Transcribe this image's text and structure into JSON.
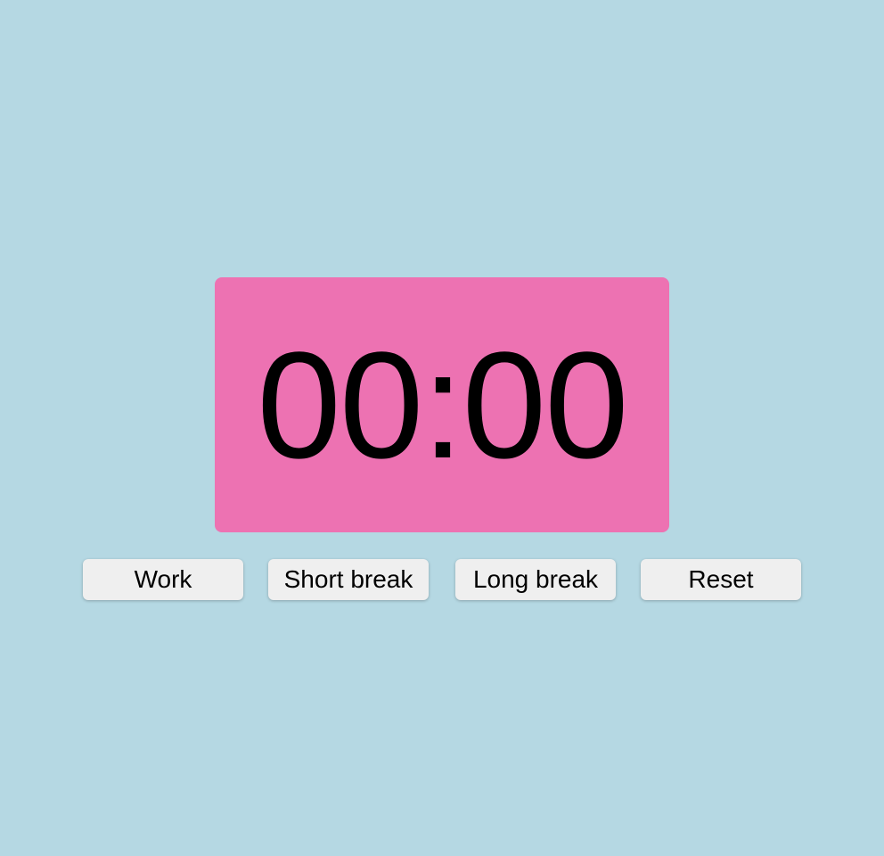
{
  "timer": {
    "display": "00:00"
  },
  "controls": {
    "work_label": "Work",
    "short_break_label": "Short break",
    "long_break_label": "Long break",
    "reset_label": "Reset"
  },
  "colors": {
    "background": "#b5d8e3",
    "timer_background": "#ed72b2",
    "button_background": "#efefef",
    "text": "#000000"
  }
}
